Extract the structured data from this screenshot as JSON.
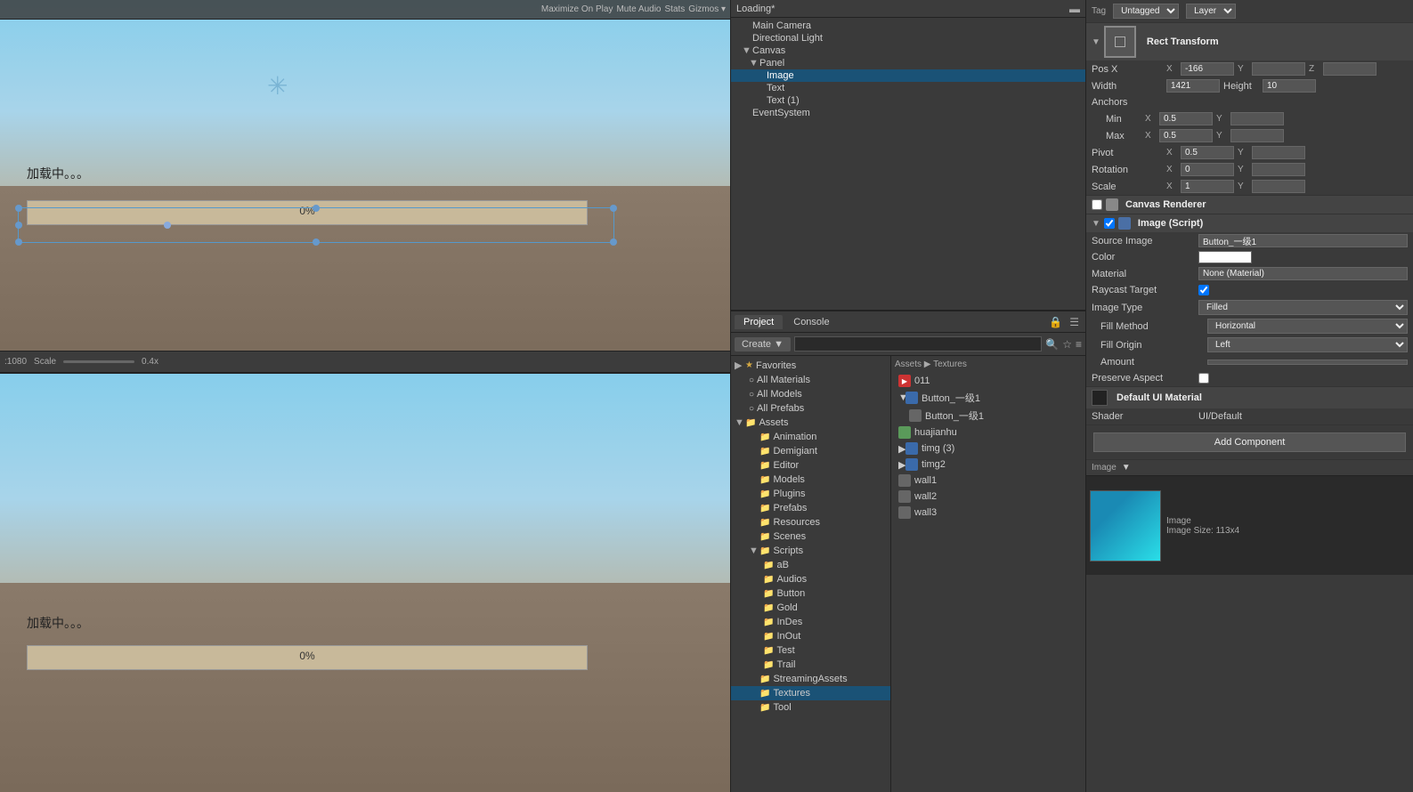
{
  "app": {
    "title": "Unity Editor"
  },
  "hierarchy": {
    "tab_label": "Loading*",
    "items": [
      {
        "id": "main-camera",
        "label": "Main Camera",
        "depth": 1,
        "arrow": "",
        "selected": false
      },
      {
        "id": "directional-light",
        "label": "Directional Light",
        "depth": 1,
        "arrow": "",
        "selected": false
      },
      {
        "id": "canvas",
        "label": "Canvas",
        "depth": 1,
        "arrow": "▼",
        "selected": false
      },
      {
        "id": "panel",
        "label": "Panel",
        "depth": 2,
        "arrow": "▼",
        "selected": false
      },
      {
        "id": "image",
        "label": "Image",
        "depth": 3,
        "arrow": "",
        "selected": true
      },
      {
        "id": "text",
        "label": "Text",
        "depth": 3,
        "arrow": "",
        "selected": false
      },
      {
        "id": "text1",
        "label": "Text (1)",
        "depth": 3,
        "arrow": "",
        "selected": false
      },
      {
        "id": "eventsystem",
        "label": "EventSystem",
        "depth": 1,
        "arrow": "",
        "selected": false
      }
    ]
  },
  "project": {
    "tab_label": "Project",
    "console_tab": "Console",
    "create_btn": "Create ▼",
    "search_placeholder": "",
    "favorites": {
      "label": "Favorites",
      "items": [
        {
          "label": "All Materials"
        },
        {
          "label": "All Models"
        },
        {
          "label": "All Prefabs"
        }
      ]
    },
    "assets_path": "Assets ▶ Textures",
    "assets": {
      "label": "Assets",
      "items": [
        {
          "label": "Animation",
          "depth": 1
        },
        {
          "label": "Demigiant",
          "depth": 1
        },
        {
          "label": "Editor",
          "depth": 1
        },
        {
          "label": "Models",
          "depth": 1
        },
        {
          "label": "Plugins",
          "depth": 1
        },
        {
          "label": "Prefabs",
          "depth": 1
        },
        {
          "label": "Resources",
          "depth": 1
        },
        {
          "label": "Scenes",
          "depth": 1
        },
        {
          "label": "Scripts",
          "depth": 1,
          "expanded": true
        },
        {
          "label": "aB",
          "depth": 2
        },
        {
          "label": "Audios",
          "depth": 2
        },
        {
          "label": "Button",
          "depth": 2
        },
        {
          "label": "Gold",
          "depth": 2
        },
        {
          "label": "InDes",
          "depth": 2
        },
        {
          "label": "InOut",
          "depth": 2
        },
        {
          "label": "Test",
          "depth": 2
        },
        {
          "label": "Trail",
          "depth": 2
        },
        {
          "label": "StreamingAssets",
          "depth": 1
        },
        {
          "label": "Textures",
          "depth": 1,
          "selected": true
        },
        {
          "label": "Tool",
          "depth": 1
        }
      ]
    },
    "texture_files": [
      {
        "label": "011",
        "type": "play",
        "color": "red"
      },
      {
        "label": "Button_一级1",
        "type": "folder",
        "color": "blue"
      },
      {
        "label": "Button_一级1",
        "type": "image",
        "color": "gray"
      },
      {
        "label": "huajianhu",
        "type": "image",
        "color": "green"
      },
      {
        "label": "timg (3)",
        "type": "image",
        "color": "blue"
      },
      {
        "label": "timg2",
        "type": "image",
        "color": "blue"
      },
      {
        "label": "wall1",
        "type": "image",
        "color": "gray"
      },
      {
        "label": "wall2",
        "type": "image",
        "color": "gray"
      },
      {
        "label": "wall3",
        "type": "image",
        "color": "gray"
      }
    ]
  },
  "inspector": {
    "tag": "Untagged",
    "layer": "Layer",
    "rect_transform": {
      "title": "Rect Transform",
      "pos_x_label": "Pos X",
      "pos_x_value": "-166",
      "pos_y_label": "Pos Y",
      "pos_y_value": "",
      "pos_z_label": "Pos Z",
      "pos_z_value": "",
      "width_label": "Width",
      "width_value": "1421",
      "height_label": "Height",
      "height_value": "10",
      "anchors_label": "Anchors",
      "anchors_min_label": "Min",
      "anchors_min_x": "0.5",
      "anchors_max_label": "Max",
      "anchors_max_x": "0.5",
      "pivot_label": "Pivot",
      "pivot_x": "0.5",
      "rotation_label": "Rotation",
      "rotation_x": "0",
      "scale_label": "Scale",
      "scale_x": "1"
    },
    "canvas_renderer": {
      "title": "Canvas Renderer"
    },
    "image_script": {
      "title": "Image (Script)",
      "source_image_label": "Source Image",
      "source_image_value": "Button_一级1",
      "color_label": "Color",
      "material_label": "Material",
      "material_value": "None (Material)",
      "raycast_label": "Raycast Target",
      "image_type_label": "Image Type",
      "image_type_value": "Filled",
      "fill_method_label": "Fill Method",
      "fill_method_value": "Horizontal",
      "fill_origin_label": "Fill Origin",
      "fill_origin_value": "Left",
      "fill_amount_label": "Amount",
      "fill_amount_value": "0",
      "preserve_label": "Preserve Aspect"
    },
    "default_ui_material": {
      "title": "Default UI Material",
      "shader_label": "Shader",
      "shader_value": "UI/Default"
    },
    "add_component_label": "Add Component",
    "preview": {
      "title": "Image",
      "size": "Image Size: 113x4"
    }
  },
  "game_view": {
    "top": {
      "loading_text": "加载中。。。",
      "percent": "0%",
      "maximize_label": "Maximize On Play",
      "mute_label": "Mute Audio",
      "stats_label": "Stats",
      "gizmos_label": "Gizmos ▾"
    },
    "bottom": {
      "loading_text": "加载中。。。",
      "percent": "0%"
    },
    "resolution": ":1080",
    "scale_label": "Scale",
    "scale_value": "0.4x"
  }
}
